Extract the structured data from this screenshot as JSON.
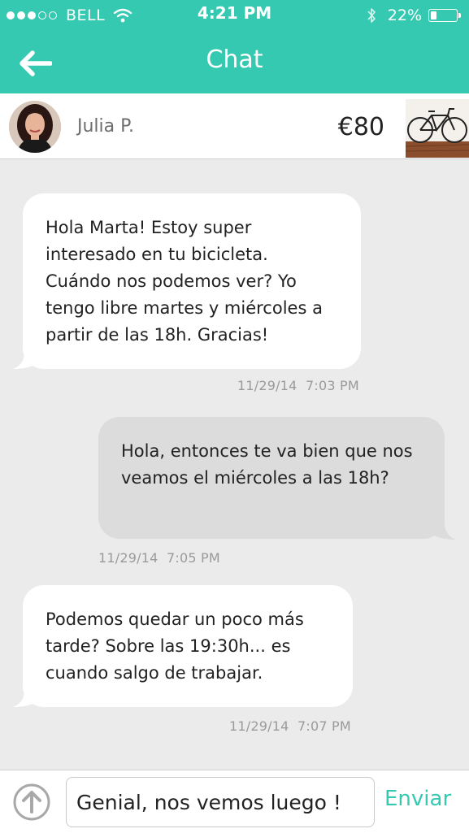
{
  "status_bar": {
    "carrier": "BELL",
    "time": "4:21 PM",
    "battery_text": "22%",
    "battery_level": 0.22,
    "signal_bars_filled": 3,
    "signal_bars_total": 5
  },
  "nav": {
    "title": "Chat",
    "back_icon": "arrow-left-icon"
  },
  "header": {
    "user_name": "Julia P.",
    "price": "€80",
    "item_icon": "bicycle-icon"
  },
  "messages": [
    {
      "direction": "incoming",
      "text": "Hola Marta! Estoy super interesado en tu bicicleta. Cuándo nos podemos ver? Yo tengo libre martes y miércoles a partir de las 18h. Gracias!",
      "timestamp": "11/29/14  7:03 PM"
    },
    {
      "direction": "outgoing",
      "text": "Hola, entonces te va bien que nos veamos el miércoles a las 18h?",
      "timestamp": "11/29/14  7:05 PM"
    },
    {
      "direction": "incoming",
      "text": "Podemos quedar un poco más tarde? Sobre las 19:30h... es cuando salgo de trabajar.",
      "timestamp": "11/29/14  7:07 PM"
    }
  ],
  "composer": {
    "input_value": "Genial, nos vemos luego !",
    "send_label": "Enviar",
    "attach_icon": "upload-arrow-icon"
  },
  "colors": {
    "accent": "#36c9b2",
    "incoming_bubble": "#ffffff",
    "outgoing_bubble": "#dcdcdc",
    "background": "#ebebeb"
  }
}
